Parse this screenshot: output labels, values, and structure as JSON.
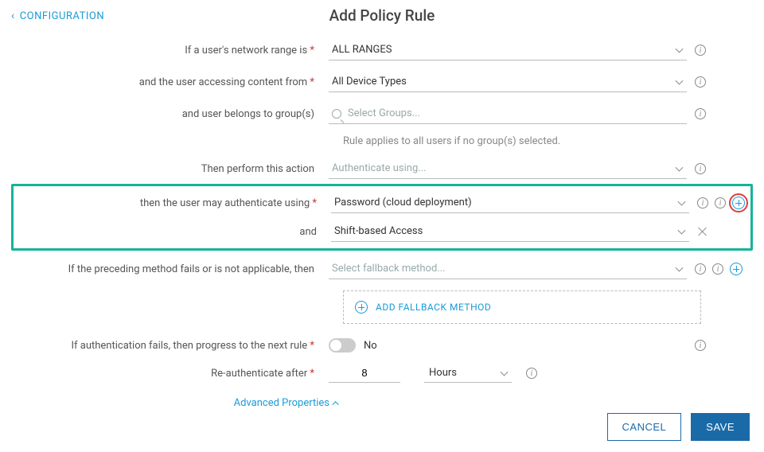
{
  "header": {
    "back_label": "Configuration",
    "title": "Add Policy Rule"
  },
  "labels": {
    "network_range": "If a user's network range is",
    "device_type": "and the user accessing content from",
    "groups": "and user belongs to group(s)",
    "groups_hint": "Rule applies to all users if no group(s) selected.",
    "action": "Then perform this action",
    "auth_using": "then the user may authenticate using",
    "and": "and",
    "fallback": "If the preceding method fails or is not applicable, then",
    "add_fallback": "Add fallback method",
    "progress_next": "If authentication fails, then progress to the next rule",
    "reauth_after": "Re-authenticate after",
    "advanced": "Advanced Properties"
  },
  "fields": {
    "network_range": {
      "value": "ALL RANGES"
    },
    "device_type": {
      "value": "All Device Types"
    },
    "groups": {
      "placeholder": "Select Groups..."
    },
    "action": {
      "value": "Authenticate using...",
      "is_placeholder": true
    },
    "auth_methods": [
      {
        "value": "Password (cloud deployment)"
      },
      {
        "value": "Shift-based Access"
      }
    ],
    "fallback": {
      "value": "Select fallback method...",
      "is_placeholder": true
    },
    "progress_next": {
      "on": false,
      "state_label": "No"
    },
    "reauth": {
      "value": "8",
      "unit": "Hours"
    }
  },
  "buttons": {
    "cancel": "CANCEL",
    "save": "SAVE"
  }
}
